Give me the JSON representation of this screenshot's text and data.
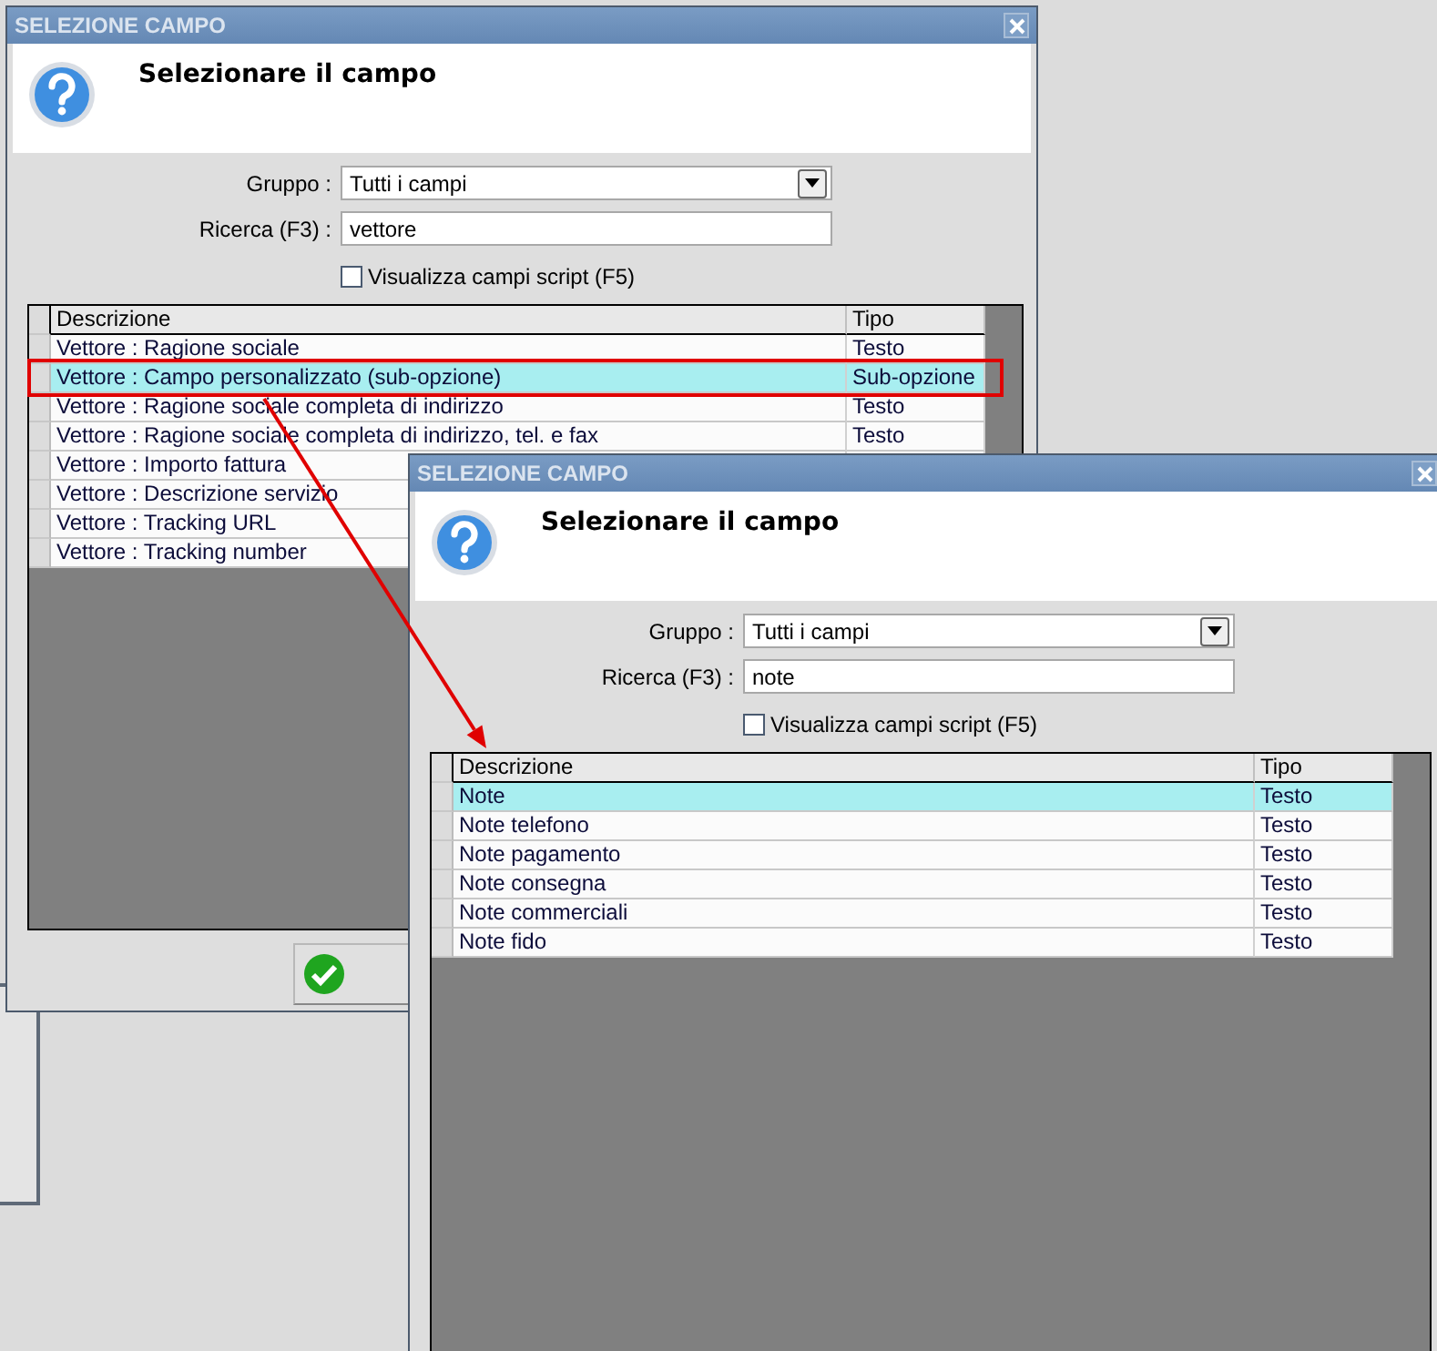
{
  "dialogs": [
    {
      "title": "SELEZIONE CAMPO",
      "heading": "Selezionare il campo",
      "group_label": "Gruppo :",
      "group_value": "Tutti i campi",
      "search_label": "Ricerca (F3) :",
      "search_value": "vettore",
      "script_checkbox": {
        "label": "Visualizza campi script (F5)",
        "checked": false
      },
      "columns": [
        "Descrizione",
        "Tipo"
      ],
      "rows": [
        {
          "description": "Vettore : Ragione sociale",
          "type": "Testo",
          "selected": false
        },
        {
          "description": "Vettore : Campo personalizzato (sub-opzione)",
          "type": "Sub-opzione",
          "selected": true
        },
        {
          "description": "Vettore : Ragione sociale completa di indirizzo",
          "type": "Testo",
          "selected": false
        },
        {
          "description": "Vettore : Ragione sociale completa di indirizzo, tel. e fax",
          "type": "Testo",
          "selected": false
        },
        {
          "description": "Vettore : Importo fattura",
          "selected": false
        },
        {
          "description": "Vettore : Descrizione servizio",
          "selected": false
        },
        {
          "description": "Vettore : Tracking URL",
          "selected": false
        },
        {
          "description": "Vettore : Tracking number",
          "selected": false
        }
      ],
      "buttons": [
        {
          "kind": "ok"
        }
      ]
    },
    {
      "title": "SELEZIONE CAMPO",
      "heading": "Selezionare il campo",
      "group_label": "Gruppo :",
      "group_value": "Tutti i campi",
      "search_label": "Ricerca (F3) :",
      "search_value": "note",
      "script_checkbox": {
        "label": "Visualizza campi script (F5)",
        "checked": false
      },
      "columns": [
        "Descrizione",
        "Tipo"
      ],
      "rows": [
        {
          "description": "Note",
          "type": "Testo",
          "selected": true
        },
        {
          "description": "Note telefono",
          "type": "Testo",
          "selected": false
        },
        {
          "description": "Note pagamento",
          "type": "Testo",
          "selected": false
        },
        {
          "description": "Note consegna",
          "type": "Testo",
          "selected": false
        },
        {
          "description": "Note commerciali",
          "type": "Testo",
          "selected": false
        },
        {
          "description": "Note fido",
          "type": "Testo",
          "selected": false
        }
      ]
    }
  ]
}
